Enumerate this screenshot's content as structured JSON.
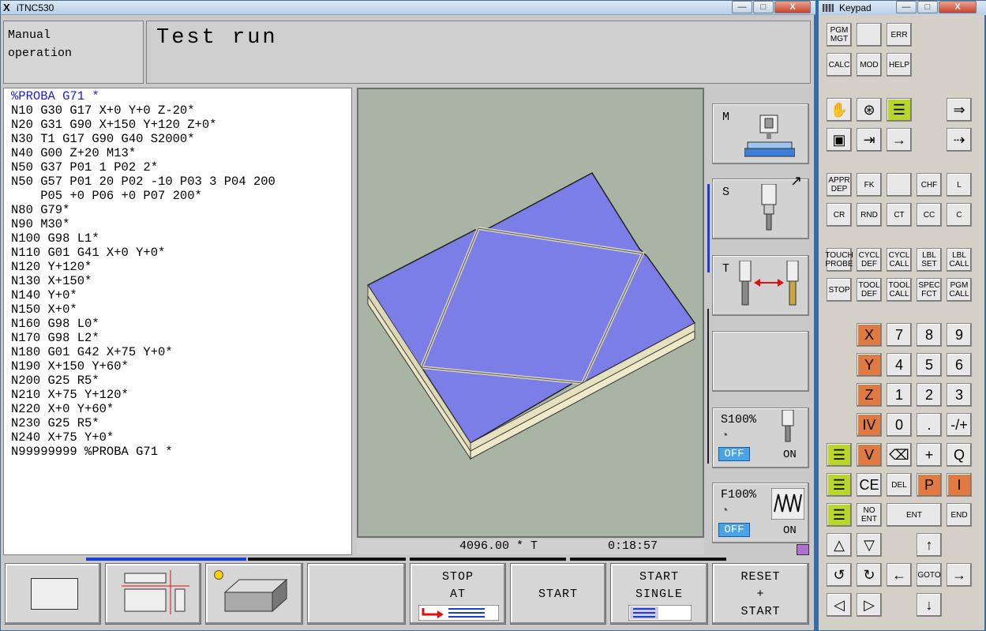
{
  "window": {
    "title": "iTNC530",
    "minimize": "—",
    "maximize": "□",
    "close": "X"
  },
  "mode": {
    "line1": "Manual",
    "line2": "operation"
  },
  "screen_title": "Test run",
  "program": [
    "%PROBA G71 *",
    "N10 G30 G17 X+0 Y+0 Z-20*",
    "N20 G31 G90 X+150 Y+120 Z+0*",
    "N30 T1 G17 G90 G40 S2000*",
    "N40 G00 Z+20 M13*",
    "N50 G37 P01 1 P02 2*",
    "N50 G57 P01 20 P02 -10 P03 3 P04 200",
    "    P05 +0 P06 +0 P07 200*",
    "N80 G79*",
    "N90 M30*",
    "N100 G98 L1*",
    "N110 G01 G41 X+0 Y+0*",
    "N120 Y+120*",
    "N130 X+150*",
    "N140 Y+0*",
    "N150 X+0*",
    "N160 G98 L0*",
    "N170 G98 L2*",
    "N180 G01 G42 X+75 Y+0*",
    "N190 X+150 Y+60*",
    "N200 G25 R5*",
    "N210 X+75 Y+120*",
    "N220 X+0 Y+60*",
    "N230 G25 R5*",
    "N240 X+75 Y+0*",
    "N99999999 %PROBA G71 *"
  ],
  "status": {
    "feed": "4096.00 * T",
    "time": "0:18:57"
  },
  "side": {
    "m": "M",
    "s": "S",
    "t": "T",
    "s_override": "S100%",
    "f_override": "F100%",
    "off": "OFF",
    "on": "ON"
  },
  "softkeys": {
    "stop_at": [
      "STOP",
      "AT"
    ],
    "start": "START",
    "start_single": [
      "START",
      "SINGLE"
    ],
    "reset_start": [
      "RESET",
      "+",
      "START"
    ]
  },
  "keypad": {
    "title": "Keypad",
    "row1": [
      "PGM MGT",
      "",
      "ERR"
    ],
    "row2": [
      "CALC",
      "MOD",
      "HELP"
    ],
    "row5": [
      "APPR DEP",
      "FK",
      "",
      "CHF",
      "L"
    ],
    "row6": [
      "CR",
      "RND",
      "CT",
      "CC",
      "C"
    ],
    "row7": [
      "TOUCH PROBE",
      "CYCL DEF",
      "CYCL CALL",
      "LBL SET",
      "LBL CALL"
    ],
    "row8": [
      "STOP",
      "TOOL DEF",
      "TOOL CALL",
      "SPEC FCT",
      "PGM CALL"
    ],
    "num": [
      [
        "X",
        "7",
        "8",
        "9"
      ],
      [
        "Y",
        "4",
        "5",
        "6"
      ],
      [
        "Z",
        "1",
        "2",
        "3"
      ],
      [
        "IV",
        "0",
        ".",
        "-/+"
      ],
      [
        "V",
        "⌫",
        "+",
        "Q"
      ]
    ],
    "ce": "CE",
    "del": "DEL",
    "p": "P",
    "i": "I",
    "no_ent": "NO ENT",
    "ent": "ENT",
    "end": "END",
    "goto": "GOTO"
  },
  "colors": {
    "graphic_bg": "#a8b5a5",
    "workpiece_top": "#7b7ee6",
    "accent_orange": "#e07a40",
    "accent_lime": "#b9d62a"
  }
}
